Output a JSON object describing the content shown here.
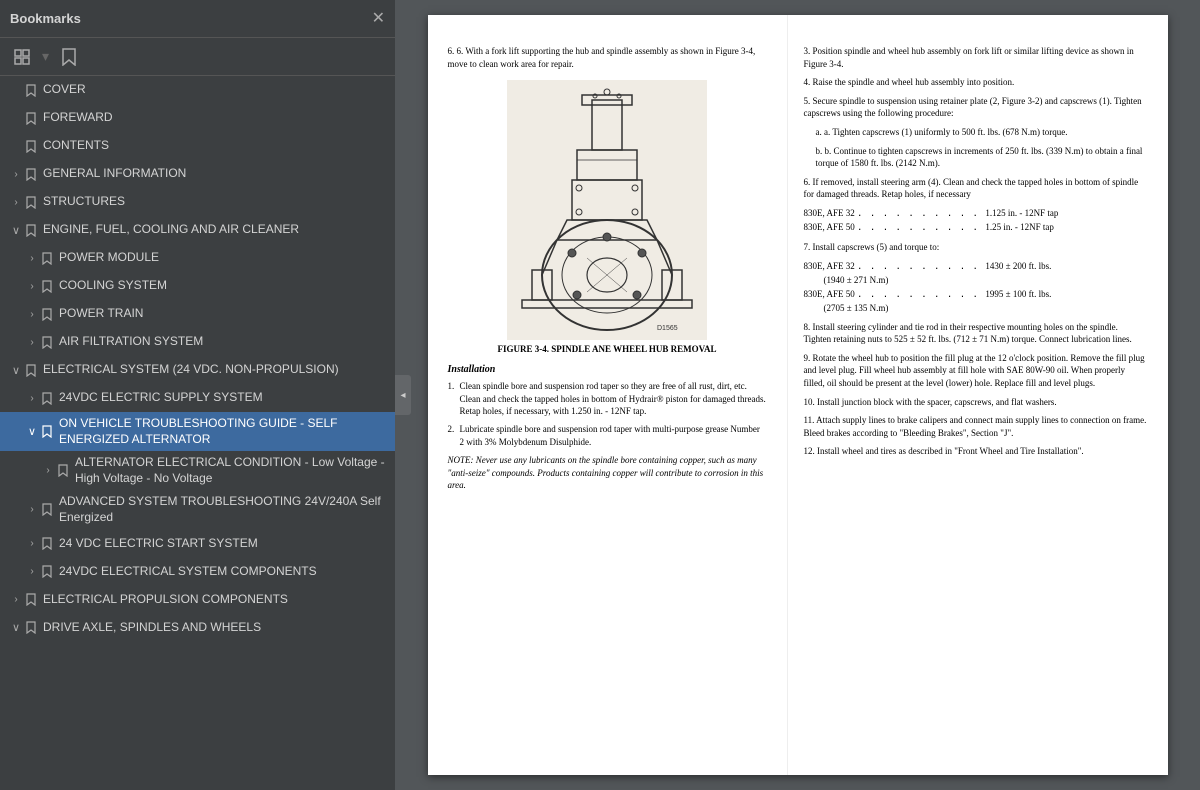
{
  "sidebar": {
    "title": "Bookmarks",
    "items": [
      {
        "id": "cover",
        "label": "COVER",
        "level": 0,
        "expanded": false,
        "selected": false,
        "hasChildren": false
      },
      {
        "id": "foreward",
        "label": "FOREWARD",
        "level": 0,
        "expanded": false,
        "selected": false,
        "hasChildren": false
      },
      {
        "id": "contents",
        "label": "CONTENTS",
        "level": 0,
        "expanded": false,
        "selected": false,
        "hasChildren": false
      },
      {
        "id": "general-info",
        "label": "GENERAL INFORMATION",
        "level": 0,
        "expanded": false,
        "selected": false,
        "hasChildren": true
      },
      {
        "id": "structures",
        "label": "STRUCTURES",
        "level": 0,
        "expanded": false,
        "selected": false,
        "hasChildren": true
      },
      {
        "id": "engine",
        "label": "ENGINE, FUEL, COOLING AND AIR CLEANER",
        "level": 0,
        "expanded": true,
        "selected": false,
        "hasChildren": true
      },
      {
        "id": "power-module",
        "label": "POWER MODULE",
        "level": 1,
        "expanded": false,
        "selected": false,
        "hasChildren": true
      },
      {
        "id": "cooling-system",
        "label": "COOLING SYSTEM",
        "level": 1,
        "expanded": false,
        "selected": false,
        "hasChildren": true
      },
      {
        "id": "power-train",
        "label": "POWER TRAIN",
        "level": 1,
        "expanded": false,
        "selected": false,
        "hasChildren": true
      },
      {
        "id": "air-filtration",
        "label": "AIR FILTRATION SYSTEM",
        "level": 1,
        "expanded": false,
        "selected": false,
        "hasChildren": true
      },
      {
        "id": "electrical-system",
        "label": "ELECTRICAL SYSTEM (24 VDC. NON-PROPULSION)",
        "level": 0,
        "expanded": true,
        "selected": false,
        "hasChildren": true
      },
      {
        "id": "24vdc-supply",
        "label": "24VDC ELECTRIC SUPPLY SYSTEM",
        "level": 1,
        "expanded": false,
        "selected": false,
        "hasChildren": true
      },
      {
        "id": "on-vehicle",
        "label": "ON VEHICLE TROUBLESHOOTING GUIDE - SELF ENERGIZED ALTERNATOR",
        "level": 1,
        "expanded": true,
        "selected": true,
        "hasChildren": true
      },
      {
        "id": "alternator-electrical",
        "label": "ALTERNATOR ELECTRICAL CONDITION - Low Voltage - High Voltage - No Voltage",
        "level": 2,
        "expanded": false,
        "selected": false,
        "hasChildren": true
      },
      {
        "id": "advanced-troubleshooting",
        "label": "ADVANCED SYSTEM TROUBLESHOOTING 24V/240A Self Energized",
        "level": 1,
        "expanded": false,
        "selected": false,
        "hasChildren": true
      },
      {
        "id": "24vdc-start",
        "label": "24 VDC ELECTRIC START SYSTEM",
        "level": 1,
        "expanded": false,
        "selected": false,
        "hasChildren": true
      },
      {
        "id": "24vdc-components",
        "label": "24VDC ELECTRICAL SYSTEM COMPONENTS",
        "level": 1,
        "expanded": false,
        "selected": false,
        "hasChildren": true
      },
      {
        "id": "electrical-propulsion",
        "label": "ELECTRICAL PROPULSION COMPONENTS",
        "level": 0,
        "expanded": false,
        "selected": false,
        "hasChildren": true
      },
      {
        "id": "drive-axle",
        "label": "DRIVE AXLE, SPINDLES AND WHEELS",
        "level": 0,
        "expanded": true,
        "selected": false,
        "hasChildren": true
      }
    ]
  },
  "toolbar": {
    "grid_icon": "▦",
    "arrow_icon": "↓",
    "bookmark_icon": "🔖"
  },
  "page": {
    "left": {
      "step6": "6. With a fork lift supporting the hub and spindle assembly as shown in Figure 3-4, move to clean work area for repair.",
      "figure_caption": "FIGURE 3-4. SPINDLE ANE WHEEL HUB REMOVAL",
      "installation_heading": "Installation",
      "install_step1": "Clean spindle bore and suspension rod taper so they are free of all rust, dirt, etc. Clean and check the tapped holes in bottom of Hydrair® piston for damaged threads. Retap holes, if necessary, with 1.250 in. - 12NF tap.",
      "install_step2": "Lubricate spindle bore and suspension rod taper with multi-purpose grease Number 2 with 3% Molybdenum Disulphide.",
      "note": "NOTE: Never use any lubricants on the spindle bore containing copper, such as many \"anti-seize\" compounds. Products containing copper will contribute to corrosion in this area."
    },
    "right": {
      "step3": "3. Position spindle and wheel hub assembly on fork lift or similar lifting device as shown in Figure 3-4.",
      "step4": "4. Raise the spindle and wheel hub assembly into position.",
      "step5_a": "5. Secure spindle to suspension using retainer plate (2, Figure 3-2) and capscrews (1). Tighten capscrews using the following procedure:",
      "step5a": "a. Tighten capscrews (1) uniformly to 500 ft. lbs. (678 N.m) torque.",
      "step5b": "b. Continue to tighten capscrews in increments of 250 ft. lbs. (339 N.m) to obtain a final torque of 1580 ft. lbs. (2142 N.m).",
      "step6": "6. If removed, install steering arm (4). Clean and check the tapped holes in bottom of spindle for damaged threads. Retap holes, if necessary",
      "spec1_label": "830E, AFE 32",
      "spec1_val": "1.125 in. - 12NF tap",
      "spec2_label": "830E, AFE 50",
      "spec2_val": "1.25 in. - 12NF tap",
      "step7": "7. Install capscrews (5) and torque to:",
      "spec3_label": "830E, AFE 32",
      "spec3_val": "1430 ± 200 ft. lbs.",
      "spec3_sub": "(1940 ± 271 N.m)",
      "spec4_label": "830E, AFE 50",
      "spec4_val": "1995 ± 100 ft. lbs.",
      "spec4_sub": "(2705 ± 135 N.m)",
      "step8": "8. Install steering cylinder and tie rod in their respective mounting holes on the spindle. Tighten retaining nuts to 525 ± 52 ft. lbs. (712 ± 71 N.m) torque. Connect lubrication lines.",
      "step9": "9. Rotate the wheel hub to position the fill plug at the 12 o'clock position. Remove the fill plug and level plug. Fill wheel hub assembly at fill hole with SAE 80W-90 oil. When properly filled, oil should be present at the level (lower) hole. Replace fill and level plugs.",
      "step10": "10. Install junction block with the spacer, capscrews, and flat washers.",
      "step11": "11. Attach supply lines to brake calipers and connect main supply lines to connection on frame. Bleed brakes according to \"Bleeding Brakes\", Section \"J\".",
      "step12": "12. Install wheel and tires as described in \"Front Wheel and Tire Installation\"."
    }
  }
}
